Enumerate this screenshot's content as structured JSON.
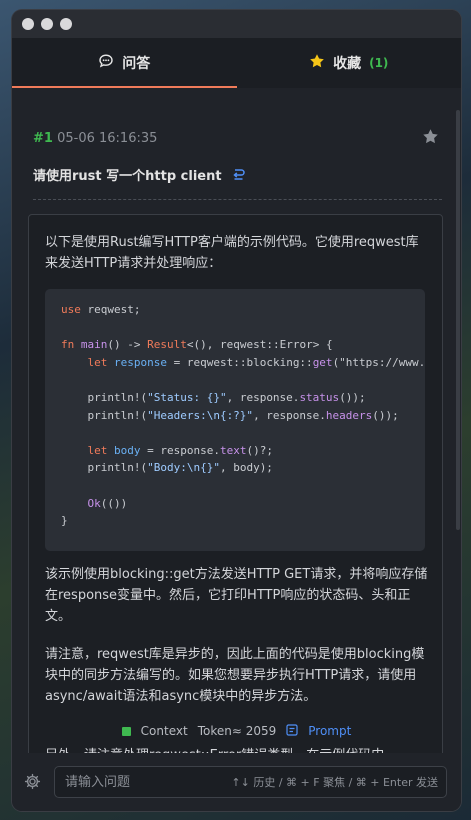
{
  "tabs": [
    {
      "label": "问答",
      "icon": "chat-icon"
    },
    {
      "label": "收藏",
      "icon": "star-icon",
      "count": "(1)"
    }
  ],
  "entry": {
    "index": "#1",
    "timestamp": "05-06 16:16:35",
    "question": "请使用rust 写一个http client"
  },
  "answer": {
    "intro": "以下是使用Rust编写HTTP客户端的示例代码。它使用reqwest库来发送HTTP请求并处理响应：",
    "p1": "该示例使用blocking::get方法发送HTTP GET请求，并将响应存储在response变量中。然后，它打印HTTP响应的状态码、头和正文。",
    "p2": "请注意，reqwest库是异步的，因此上面的代码是使用blocking模块中的同步方法编写的。如果您想要异步执行HTTP请求，请使用async/await语法和async模块中的异步方法。",
    "p3": "另外，请注意处理reqwest::Error错误类型。在示例代码中，"
  },
  "code_lines": [
    "use reqwest;",
    "",
    "fn main() -> Result<(), reqwest::Error> {",
    "    let response = reqwest::blocking::get(\"https://www.",
    "",
    "    println!(\"Status: {}\", response.status());",
    "    println!(\"Headers:\\n{:?}\", response.headers());",
    "",
    "    let body = response.text()?;",
    "    println!(\"Body:\\n{}\", body);",
    "",
    "    Ok(())",
    "}"
  ],
  "status": {
    "context": "Context",
    "tokens": "Token≈ 2059",
    "prompt": "Prompt"
  },
  "input": {
    "placeholder": "请输入问题",
    "hint": "↑↓ 历史 / ⌘ + F 聚焦 / ⌘ + Enter 发送"
  },
  "colors": {
    "accent": "#f07b5a",
    "green": "#3fb950",
    "link": "#4f8ff7"
  }
}
